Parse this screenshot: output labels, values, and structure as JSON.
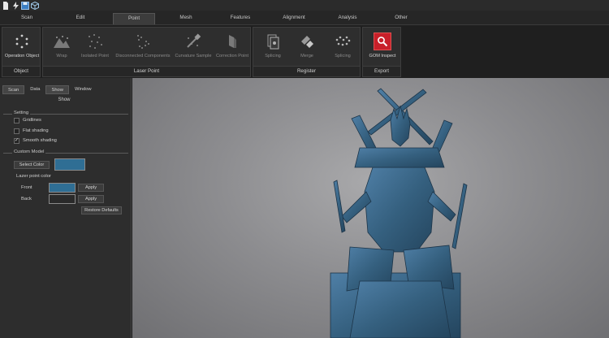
{
  "quick_access": {
    "icons": [
      "new-file-icon",
      "lightning-icon",
      "save-icon",
      "view-cube-icon"
    ]
  },
  "tabs": [
    {
      "label": "Scan",
      "active": false
    },
    {
      "label": "Edit",
      "active": false
    },
    {
      "label": "Point",
      "active": true
    },
    {
      "label": "Mesh",
      "active": false
    },
    {
      "label": "Features",
      "active": false
    },
    {
      "label": "Alignment",
      "active": false
    },
    {
      "label": "Analysis",
      "active": false
    },
    {
      "label": "Other",
      "active": false
    }
  ],
  "ribbon": {
    "groups": {
      "object": {
        "label": "Object",
        "buttons": [
          "Operation Object"
        ]
      },
      "laser_point": {
        "label": "Laser Point",
        "buttons": [
          "Wrap",
          "Isolated Point",
          "Disconnected Components",
          "Curvature Sample",
          "Correction Point"
        ]
      },
      "register": {
        "label": "Register",
        "buttons": [
          "Splicing",
          "Merge",
          "Splicing"
        ]
      },
      "export": {
        "label": "Export",
        "buttons": [
          "GOM Inspect"
        ]
      }
    }
  },
  "panel": {
    "tabs": [
      "Scan",
      "Data",
      "Show",
      "Window"
    ],
    "active_tab": "Show",
    "title": "Show",
    "setting": {
      "label": "Setting",
      "gridlines": {
        "label": "Gridlines",
        "checked": false
      },
      "flat_shading": {
        "label": "Flat shading",
        "checked": false
      },
      "smooth_shading": {
        "label": "Smooth shading",
        "checked": true
      }
    },
    "custom_model": {
      "label": "Custom Model",
      "select_color_label": "Select Color",
      "model_color": "#2f6e94",
      "laser_point_color_label": "Lazer point color",
      "front_label": "Front",
      "front_color": "#2f6e94",
      "back_label": "Back",
      "back_color": "#2a2a2a",
      "apply_label": "Apply",
      "restore_label": "Restore Defaults"
    }
  },
  "colors": {
    "accent": "#c8202a",
    "model": "#3a6688"
  }
}
